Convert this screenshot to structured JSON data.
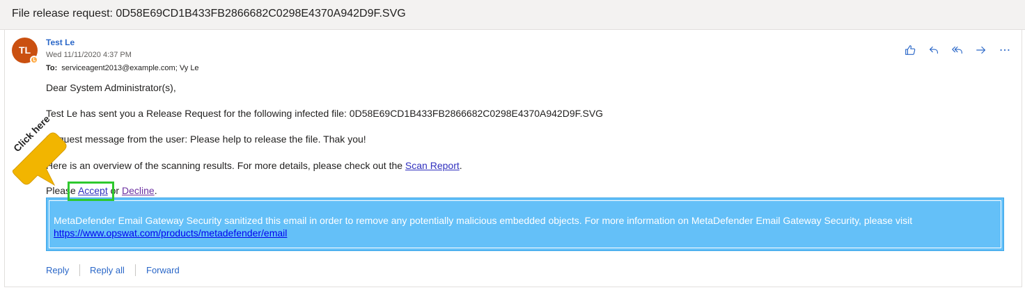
{
  "header": {
    "subject": "File release request: 0D58E69CD1B433FB2866682C0298E4370A942D9F.SVG"
  },
  "message": {
    "avatar_initials": "TL",
    "sender_name": "Test Le",
    "datetime": "Wed 11/11/2020 4:37 PM",
    "to_label": "To:",
    "recipients": "serviceagent2013@example.com; Vy Le"
  },
  "actions": [
    {
      "name": "like-icon"
    },
    {
      "name": "reply-icon"
    },
    {
      "name": "reply-all-icon"
    },
    {
      "name": "forward-icon"
    },
    {
      "name": "more-icon"
    }
  ],
  "body": {
    "greeting": "Dear System Administrator(s),",
    "line1": "Test Le has sent you a Release Request for the following infected file: 0D58E69CD1B433FB2866682C0298E4370A942D9F.SVG",
    "line2": "Request message from the user: Please help to release the file. Thak you!",
    "line3_prefix": "Here is an overview of the scanning results. For more details, please check out the ",
    "scan_report_link": "Scan Report",
    "line3_suffix": ".",
    "line4_prefix": "Please ",
    "accept_link": "Accept",
    "line4_or": " or ",
    "decline_link": "Decline",
    "line4_suffix": "."
  },
  "banner": {
    "text": "MetaDefender Email Gateway Security sanitized this email in order to remove any potentially malicious embedded objects. For more information on MetaDefender Email Gateway Security, please visit",
    "link": "https://www.opswat.com/products/metadefender/email"
  },
  "footer": {
    "reply": "Reply",
    "reply_all": "Reply all",
    "forward": "Forward"
  },
  "callout": {
    "text": "Click here"
  },
  "colors": {
    "accent": "#2a67c8",
    "avatar": "#ca5010",
    "banner": "#64c0f8",
    "highlight": "#2ec92e",
    "callout": "#f2b500"
  }
}
